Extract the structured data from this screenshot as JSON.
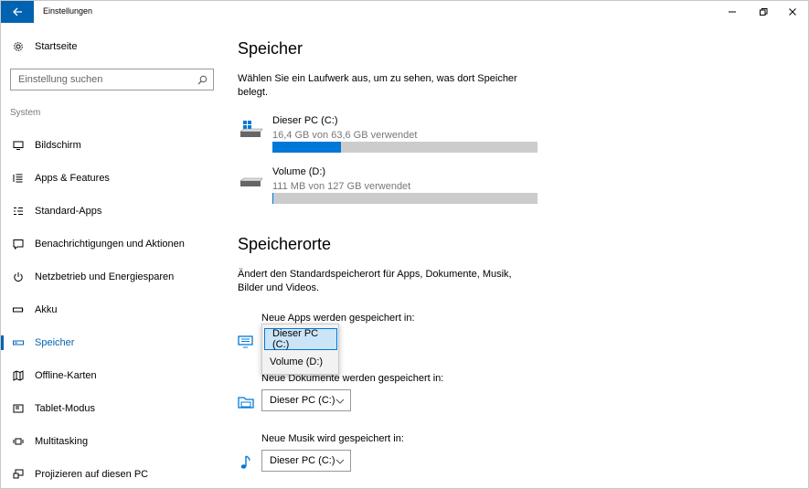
{
  "window": {
    "title": "Einstellungen",
    "accent": "#0063b1",
    "icons": {
      "back": "back-arrow-icon",
      "minimize": "minimize-icon",
      "maximize": "restore-icon",
      "close": "close-icon"
    }
  },
  "sidebar": {
    "home_label": "Startseite",
    "search_placeholder": "Einstellung suchen",
    "group_label": "System",
    "items": [
      {
        "label": "Bildschirm",
        "icon": "monitor-icon"
      },
      {
        "label": "Apps & Features",
        "icon": "list-icon"
      },
      {
        "label": "Standard-Apps",
        "icon": "default-apps-icon"
      },
      {
        "label": "Benachrichtigungen und Aktionen",
        "icon": "notification-icon"
      },
      {
        "label": "Netzbetrieb und Energiesparen",
        "icon": "power-icon"
      },
      {
        "label": "Akku",
        "icon": "battery-icon"
      },
      {
        "label": "Speicher",
        "icon": "storage-icon",
        "active": true
      },
      {
        "label": "Offline-Karten",
        "icon": "map-icon"
      },
      {
        "label": "Tablet-Modus",
        "icon": "tablet-icon"
      },
      {
        "label": "Multitasking",
        "icon": "multitasking-icon"
      },
      {
        "label": "Projizieren auf diesen PC",
        "icon": "project-icon"
      }
    ]
  },
  "main": {
    "storage_title": "Speicher",
    "storage_desc": "Wählen Sie ein Laufwerk aus, um zu sehen, was dort Speicher belegt.",
    "drives": [
      {
        "name": "Dieser PC (C:)",
        "usage": "16,4 GB von 63,6 GB verwendet",
        "used_fraction": 0.258,
        "icon": "windows-drive-icon"
      },
      {
        "name": "Volume (D:)",
        "usage": "111 MB von 127 GB verwendet",
        "used_fraction": 0.001,
        "icon": "drive-icon"
      }
    ],
    "locations_title": "Speicherorte",
    "locations_desc": "Ändert den Standardspeicherort für Apps, Dokumente, Musik, Bilder und Videos.",
    "locations": [
      {
        "label": "Neue Apps werden gespeichert in:",
        "value": "Dieser PC (C:)",
        "icon": "apps-monitor-icon"
      },
      {
        "label": "Neue Dokumente werden gespeichert in:",
        "value": "Dieser PC (C:)",
        "icon": "folder-icon"
      },
      {
        "label": "Neue Musik wird gespeichert in:",
        "value": "Dieser PC (C:)",
        "icon": "music-note-icon"
      }
    ],
    "dropdown": {
      "options": [
        "Dieser PC (C:)",
        "Volume (D:)"
      ],
      "selected": "Dieser PC (C:)"
    }
  }
}
